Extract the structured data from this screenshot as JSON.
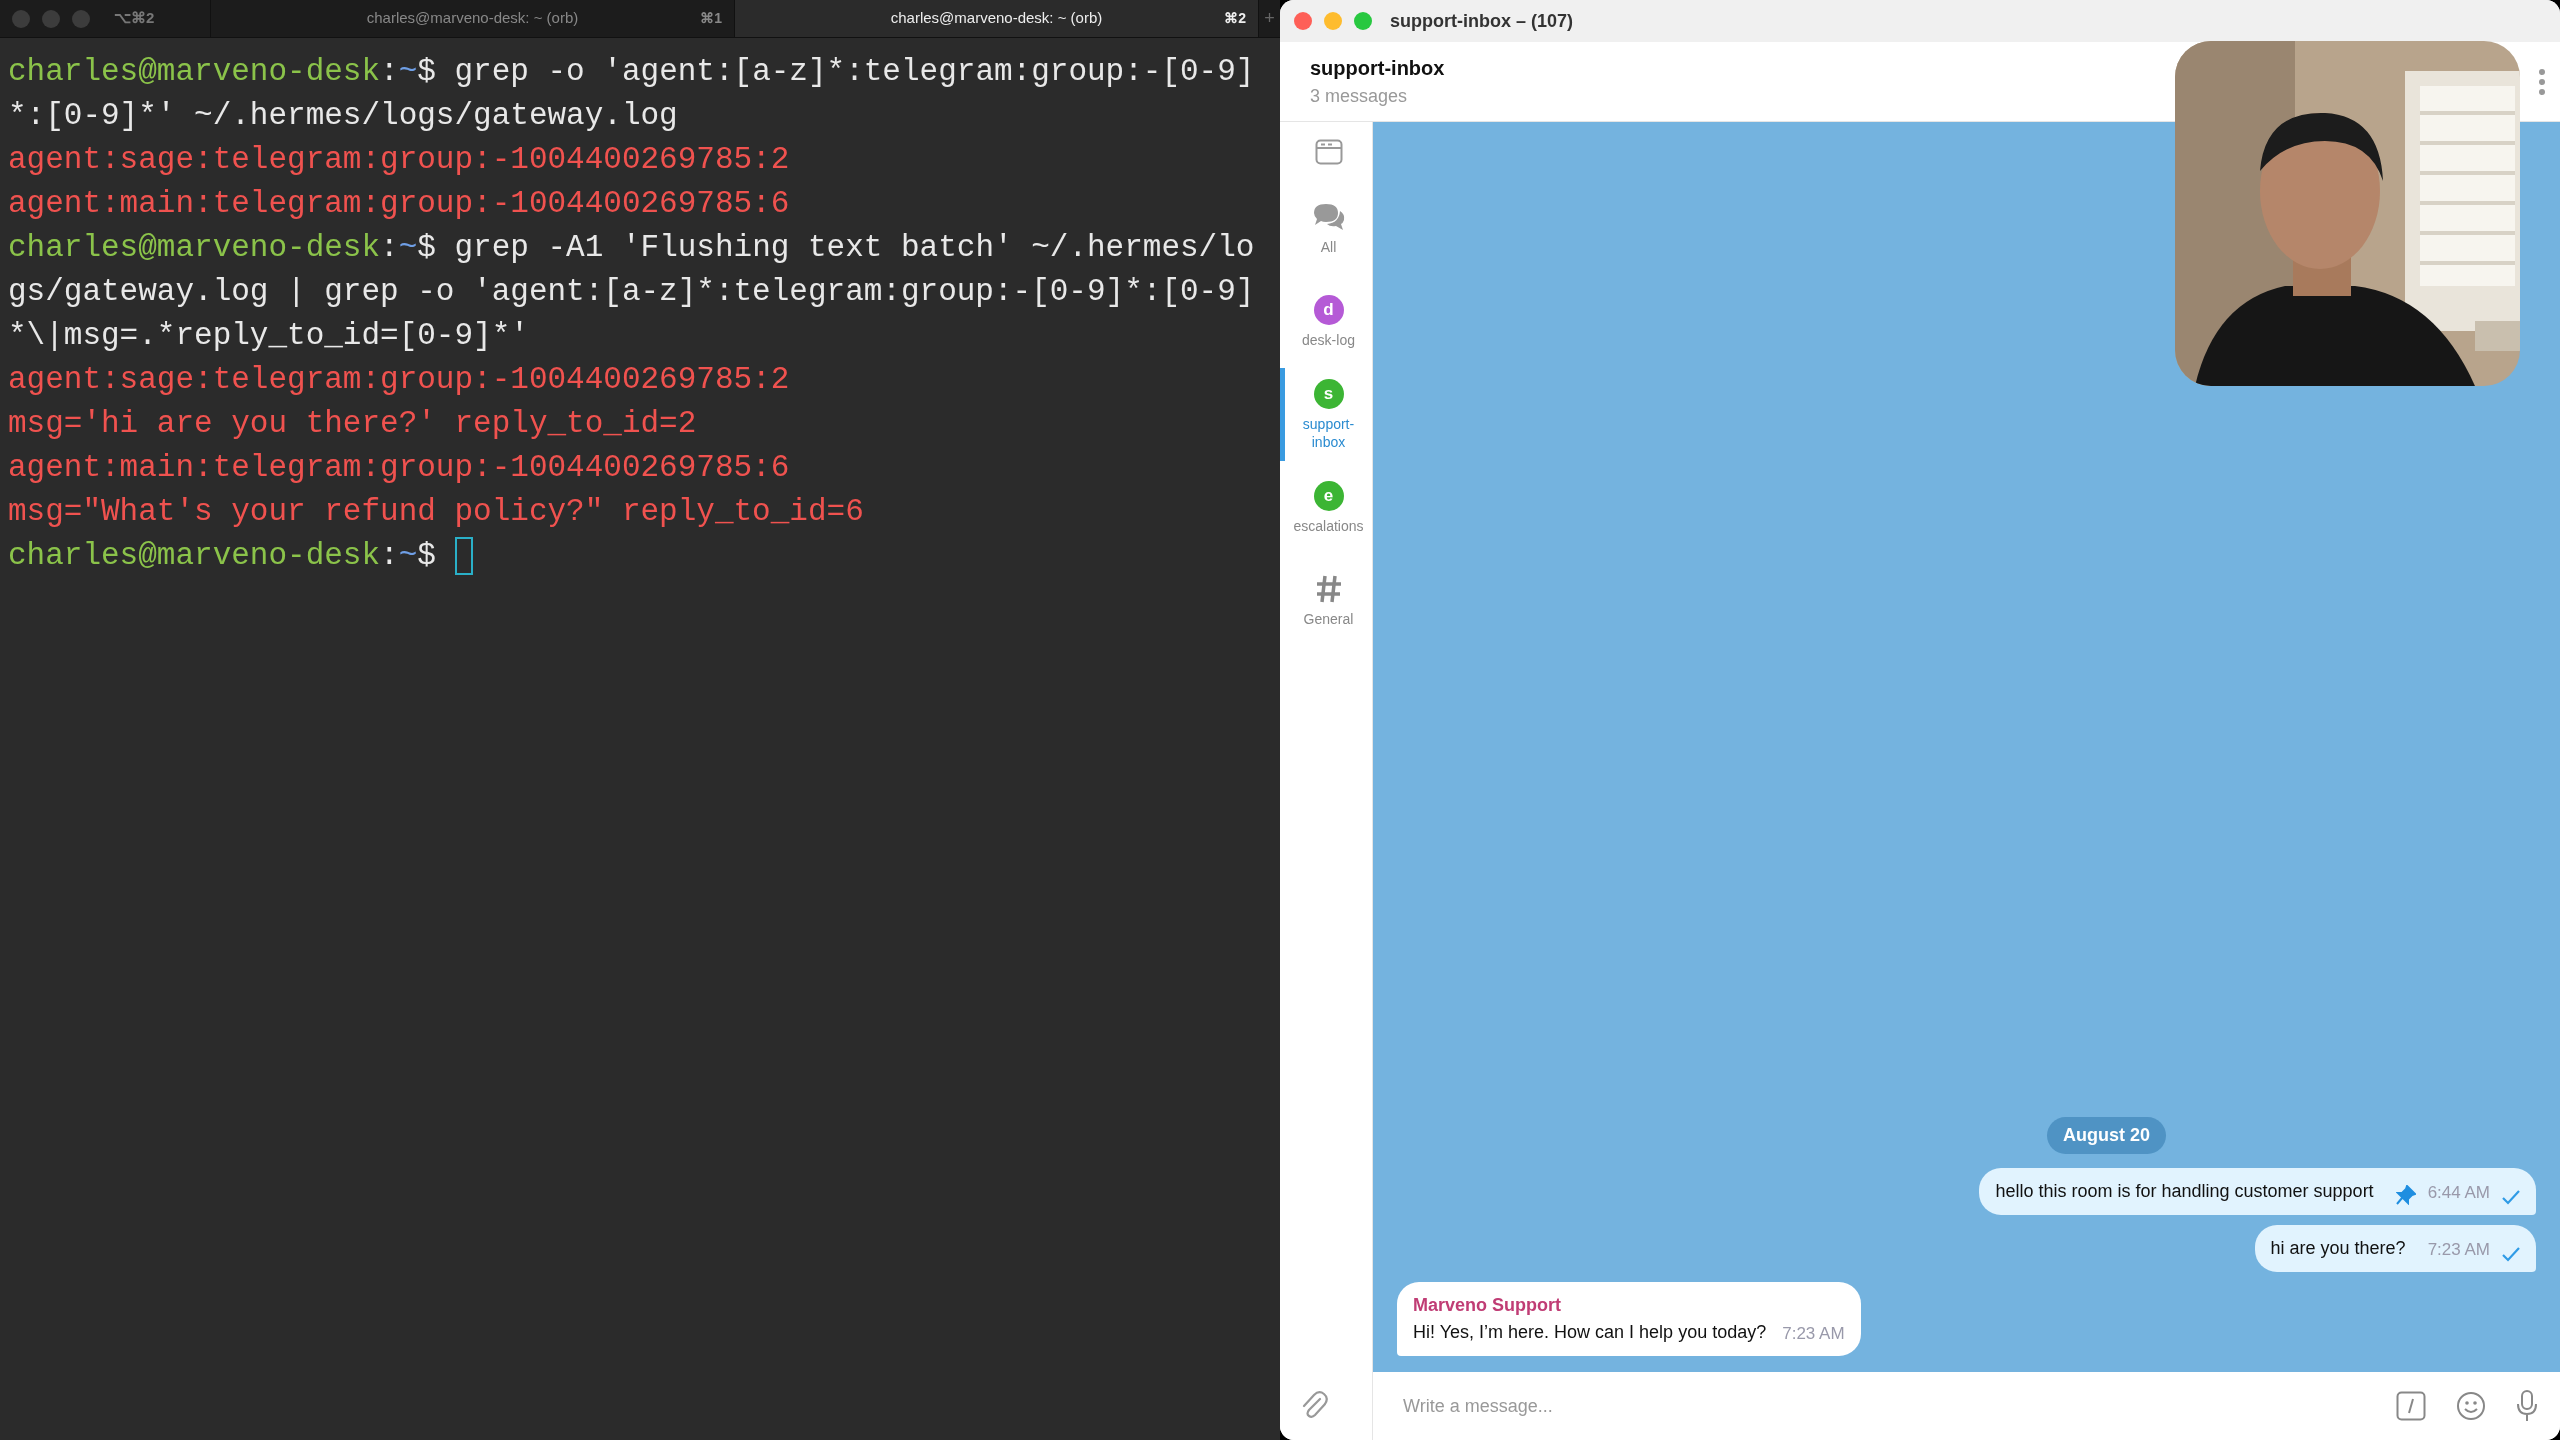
{
  "terminal": {
    "tab_bar": {
      "shortcut": "⌥⌘2",
      "new_tab": "+",
      "tabs": [
        {
          "title": "charles@marveno-desk: ~ (orb)",
          "shortcut": "⌘1",
          "selected": false
        },
        {
          "title": "charles@marveno-desk: ~ (orb)",
          "shortcut": "⌘2",
          "selected": true
        }
      ]
    },
    "lines": [
      {
        "kind": "command",
        "prompt": {
          "user_host": "charles@marveno-desk",
          "separator": ":",
          "path": "~",
          "symbol": "$"
        },
        "text": "grep -o 'agent:[a-z]*:telegram:group:-[0-9]*:[0-9]*' ~/.hermes/logs/gateway.log"
      },
      {
        "kind": "output",
        "text": "agent:sage:telegram:group:-1004400269785:2"
      },
      {
        "kind": "output",
        "text": "agent:main:telegram:group:-1004400269785:6"
      },
      {
        "kind": "command",
        "prompt": {
          "user_host": "charles@marveno-desk",
          "separator": ":",
          "path": "~",
          "symbol": "$"
        },
        "text": "grep -A1 'Flushing text batch' ~/.hermes/logs/gateway.log | grep -o 'agent:[a-z]*:telegram:group:-[0-9]*:[0-9]*\\|msg=.*reply_to_id=[0-9]*'"
      },
      {
        "kind": "output",
        "text": "agent:sage:telegram:group:-1004400269785:2"
      },
      {
        "kind": "output",
        "text": "msg='hi are you there?' reply_to_id=2"
      },
      {
        "kind": "output",
        "text": "agent:main:telegram:group:-1004400269785:6"
      },
      {
        "kind": "output",
        "text": "msg=\"What's your refund policy?\" reply_to_id=6"
      },
      {
        "kind": "prompt",
        "prompt": {
          "user_host": "charles@marveno-desk",
          "separator": ":",
          "path": "~",
          "symbol": "$"
        }
      }
    ]
  },
  "telegram": {
    "window": {
      "title": "support-inbox – (107)"
    },
    "header": {
      "title": "support-inbox",
      "subtitle": "3 messages"
    },
    "sidebar": {
      "items": [
        {
          "kind": "folders",
          "selected": false
        },
        {
          "kind": "chats",
          "label": "All",
          "selected": false
        },
        {
          "kind": "avatar",
          "letter": "d",
          "color": "#b55ad6",
          "label": "desk-log",
          "selected": false
        },
        {
          "kind": "avatar",
          "letter": "s",
          "color": "#3cb534",
          "label": "support-\ninbox",
          "selected": true
        },
        {
          "kind": "avatar",
          "letter": "e",
          "color": "#3cb534",
          "label": "escalations",
          "selected": false
        },
        {
          "kind": "hash",
          "label": "General",
          "selected": false
        }
      ]
    },
    "chat": {
      "date": "August 20",
      "messages": [
        {
          "kind": "out",
          "text": "hello this room is for handling customer support",
          "pinned": true,
          "time": "6:44 AM"
        },
        {
          "kind": "out",
          "text": "hi are you there?",
          "pinned": false,
          "time": "7:23 AM"
        },
        {
          "kind": "in",
          "sender": "Marveno Support",
          "text": "Hi! Yes, I’m here. How can I help you today?",
          "pinned": false,
          "time": "7:23 AM"
        }
      ]
    },
    "composer": {
      "placeholder": "Write a message..."
    }
  }
}
